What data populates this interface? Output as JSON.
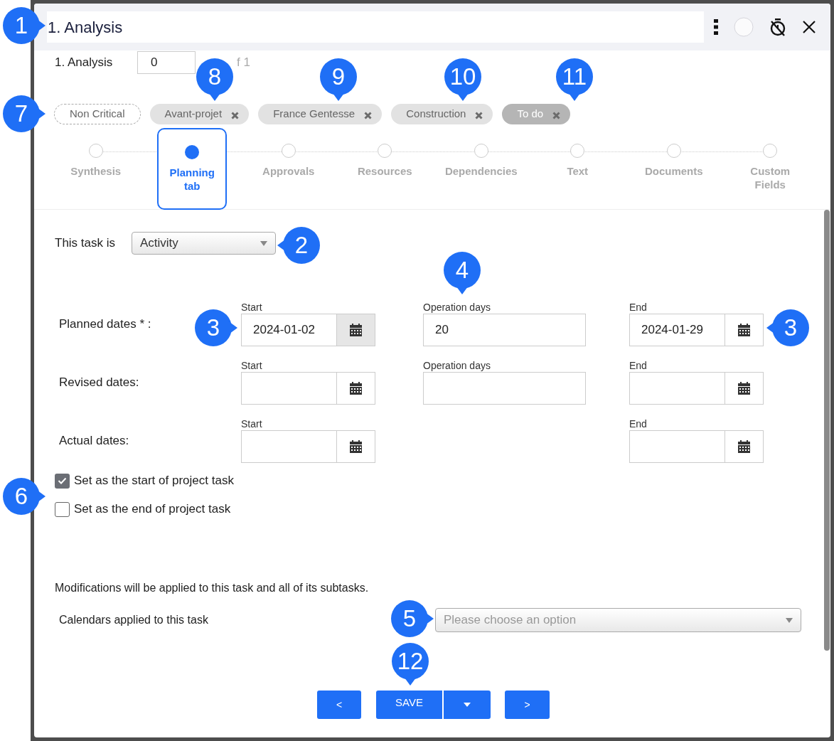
{
  "header": {
    "title": "1. Analysis"
  },
  "task_row": {
    "label": "1. Analysis",
    "value": "0",
    "total": "f 1"
  },
  "chips": [
    {
      "label": "Non Critical",
      "kind": "outline"
    },
    {
      "label": "Avant-projet",
      "kind": "removable"
    },
    {
      "label": "France Gentesse",
      "kind": "removable"
    },
    {
      "label": "Construction",
      "kind": "removable"
    },
    {
      "label": "To do",
      "kind": "faded"
    }
  ],
  "steps": [
    {
      "label": "Synthesis",
      "selected": false
    },
    {
      "label": "Planning tab",
      "selected": true
    },
    {
      "label": "Approvals",
      "selected": false
    },
    {
      "label": "Resources",
      "selected": false
    },
    {
      "label": "Dependencies",
      "selected": false
    },
    {
      "label": "Text",
      "selected": false
    },
    {
      "label": "Documents",
      "selected": false
    },
    {
      "label": "Custom Fields",
      "selected": false
    }
  ],
  "task_type": {
    "label": "This task is",
    "value": "Activity"
  },
  "date_rows": [
    {
      "label": "Planned dates * :",
      "start": {
        "label": "Start",
        "value": "2024-01-02",
        "pressed": true
      },
      "operation_days": {
        "label": "Operation days",
        "value": "20"
      },
      "end": {
        "label": "End",
        "value": "2024-01-29",
        "pressed": false
      }
    },
    {
      "label": "Revised dates:",
      "start": {
        "label": "Start",
        "pressed": false
      },
      "operation_days": {
        "label": "Operation days"
      },
      "end": {
        "label": "End",
        "pressed": false
      }
    },
    {
      "label": "Actual dates:",
      "start": {
        "label": "Start",
        "pressed": false
      },
      "end": {
        "label": "End",
        "pressed": false
      }
    }
  ],
  "checkboxes": [
    {
      "label": "Set as the start of project task",
      "checked": true
    },
    {
      "label": "Set as the end of project task",
      "checked": false
    }
  ],
  "note": "Modifications will be applied to this task and all of its subtasks.",
  "calendars": {
    "label": "Calendars applied to this task",
    "placeholder": "Please choose an option"
  },
  "buttons": {
    "previous": "<",
    "save": "SAVE",
    "next": ">"
  },
  "callouts": [
    {
      "number": "1"
    },
    {
      "number": "8"
    },
    {
      "number": "9"
    },
    {
      "number": "10"
    },
    {
      "number": "11"
    },
    {
      "number": "7"
    },
    {
      "number": "2"
    },
    {
      "number": "4"
    },
    {
      "number": "3"
    },
    {
      "number": "3"
    },
    {
      "number": "6"
    },
    {
      "number": "5"
    },
    {
      "number": "12"
    }
  ]
}
